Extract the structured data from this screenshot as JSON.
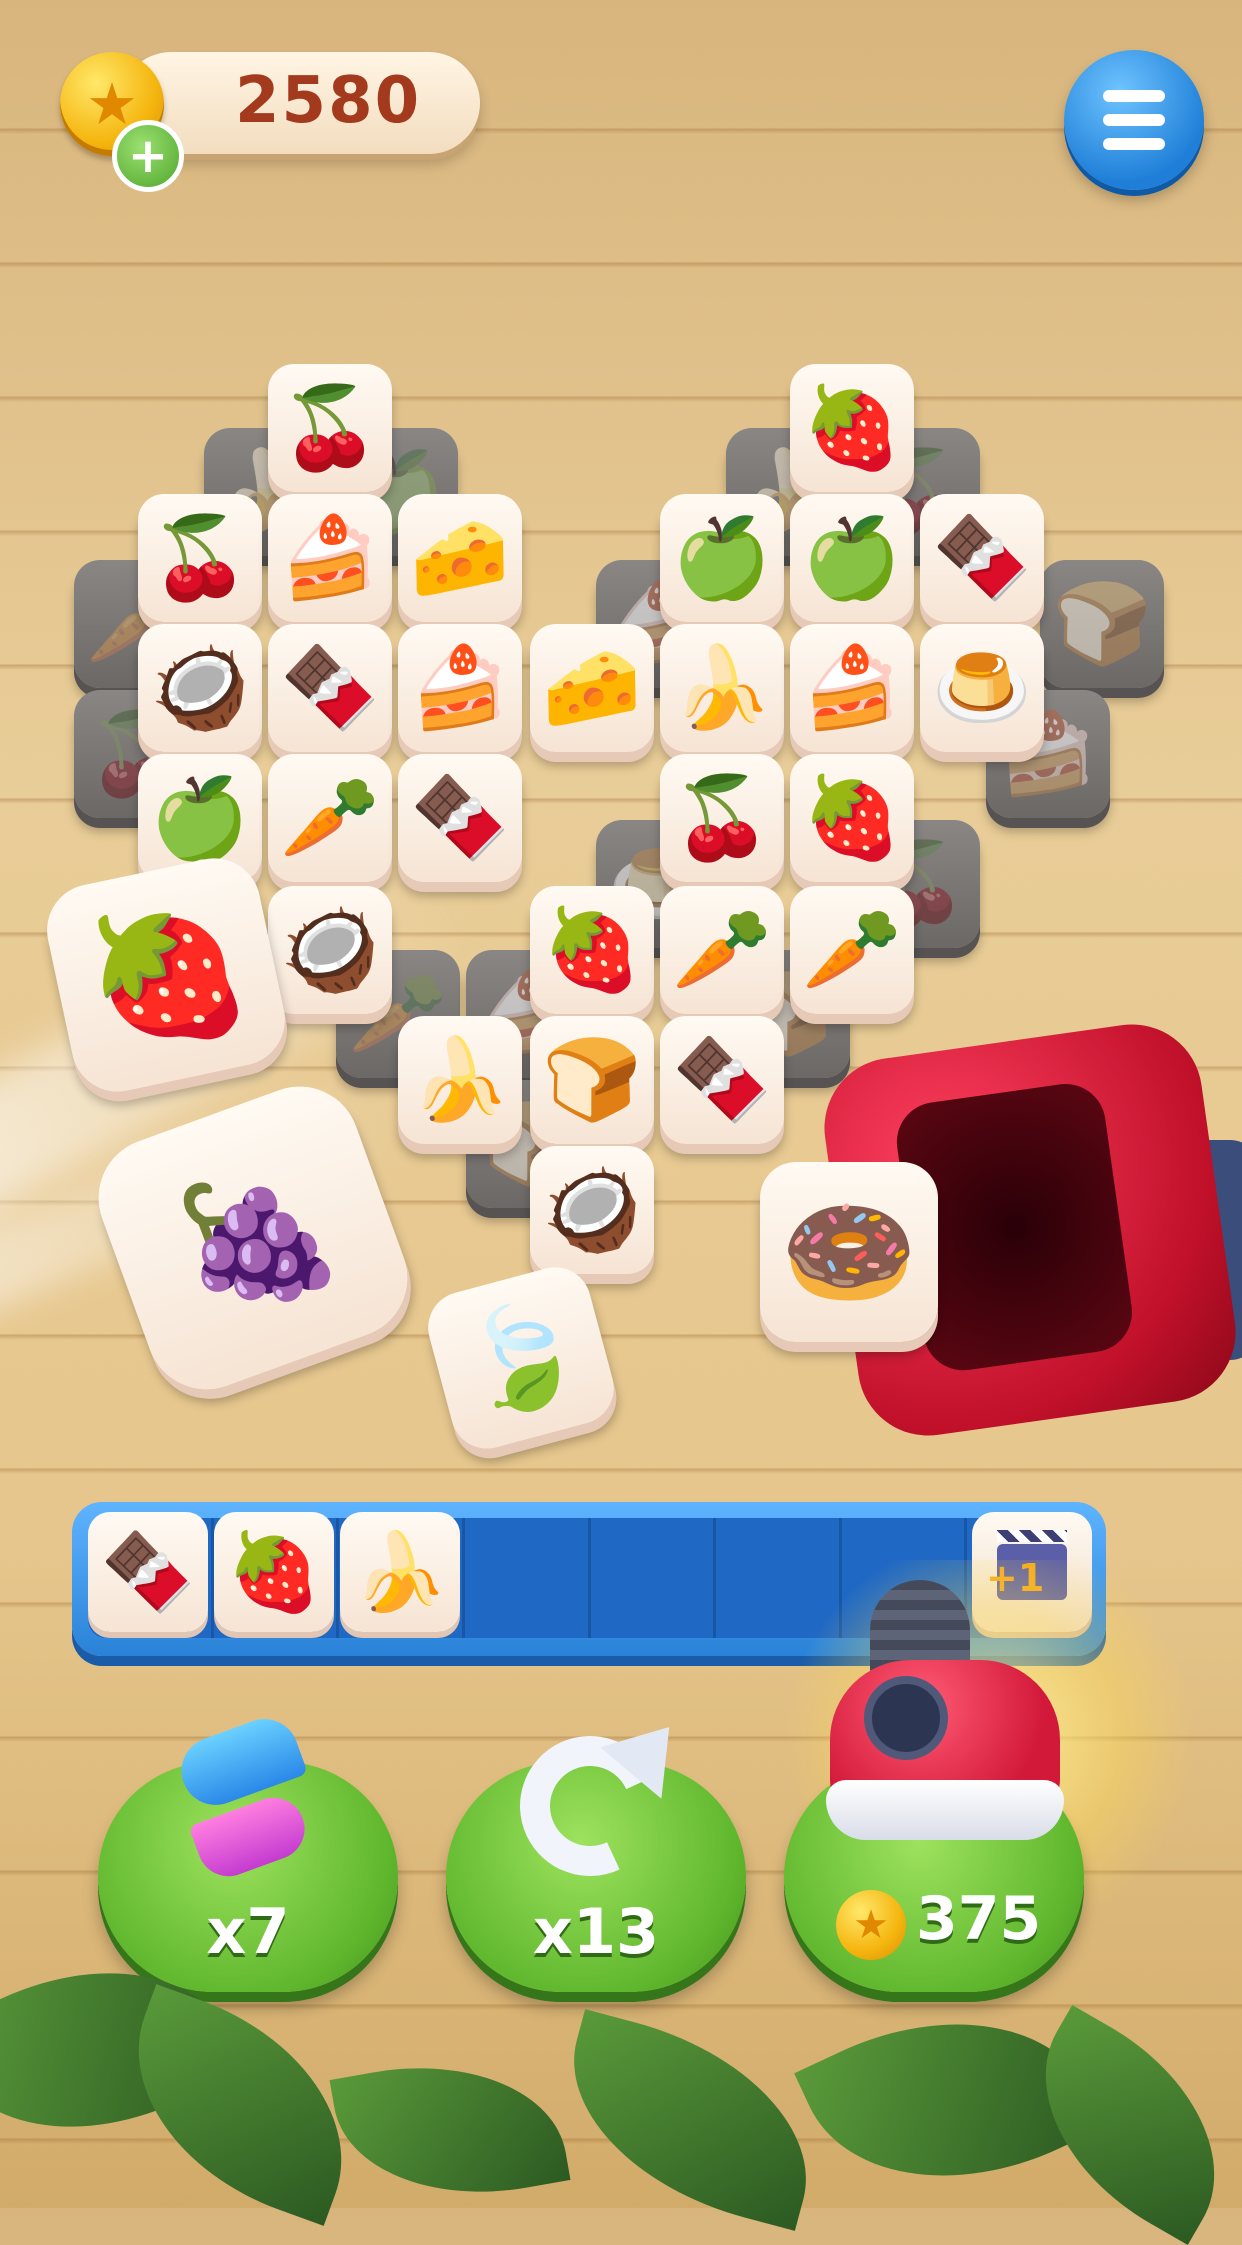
{
  "header": {
    "coins": "2580"
  },
  "board": {
    "tiles": [
      {
        "icon": "🍒",
        "name": "cherry-tile"
      },
      {
        "icon": "🍓",
        "name": "strawberry-tile"
      },
      {
        "icon": "🍒",
        "name": "cherry-tile"
      },
      {
        "icon": "🍰",
        "name": "cake-tile"
      },
      {
        "icon": "🧀",
        "name": "cheese-tile"
      },
      {
        "icon": "🍏",
        "name": "apple-tile"
      },
      {
        "icon": "🍏",
        "name": "apple-tile"
      },
      {
        "icon": "🍫",
        "name": "chocolate-tile"
      },
      {
        "icon": "🥥",
        "name": "coconut-tile"
      },
      {
        "icon": "🍫",
        "name": "chocolate-tile"
      },
      {
        "icon": "🍰",
        "name": "cake-tile"
      },
      {
        "icon": "🧀",
        "name": "cheese-tile"
      },
      {
        "icon": "🍌",
        "name": "banana-tile"
      },
      {
        "icon": "🍰",
        "name": "cake-tile"
      },
      {
        "icon": "🍮",
        "name": "jelly-tile"
      },
      {
        "icon": "🍏",
        "name": "apple-tile"
      },
      {
        "icon": "🥕",
        "name": "carrot-tile"
      },
      {
        "icon": "🍫",
        "name": "chocolate-tile"
      },
      {
        "icon": "🍒",
        "name": "cherry-tile"
      },
      {
        "icon": "🍓",
        "name": "strawberry-tile"
      },
      {
        "icon": "🥥",
        "name": "coconut-tile"
      },
      {
        "icon": "🍓",
        "name": "strawberry-tile"
      },
      {
        "icon": "🥕",
        "name": "carrot-tile"
      },
      {
        "icon": "🥕",
        "name": "carrot-tile"
      },
      {
        "icon": "🍌",
        "name": "banana-tile"
      },
      {
        "icon": "🍞",
        "name": "bread-tile"
      },
      {
        "icon": "🍫",
        "name": "chocolate-tile"
      },
      {
        "icon": "🥥",
        "name": "coconut-tile"
      }
    ],
    "flying": [
      {
        "icon": "🍓",
        "name": "flying-strawberry-tile"
      },
      {
        "icon": "🍇",
        "name": "flying-grapes-tile"
      },
      {
        "icon": "🍃",
        "name": "flying-leaf-tile"
      },
      {
        "icon": "🍩",
        "name": "flying-donut-tile"
      }
    ]
  },
  "tray": {
    "tiles": [
      {
        "icon": "🍫",
        "name": "tray-chocolate-tile"
      },
      {
        "icon": "🍓",
        "name": "tray-strawberry-tile"
      },
      {
        "icon": "🍌",
        "name": "tray-banana-tile"
      }
    ],
    "add_slot_label": "+1"
  },
  "boosters": {
    "shuffle_count": "x7",
    "undo_count": "x13",
    "vacuum_price": "375"
  },
  "colors": {
    "accent_blue": "#2a82d8",
    "booster_green": "#5fb72d",
    "coin_text": "#a43a1d"
  }
}
